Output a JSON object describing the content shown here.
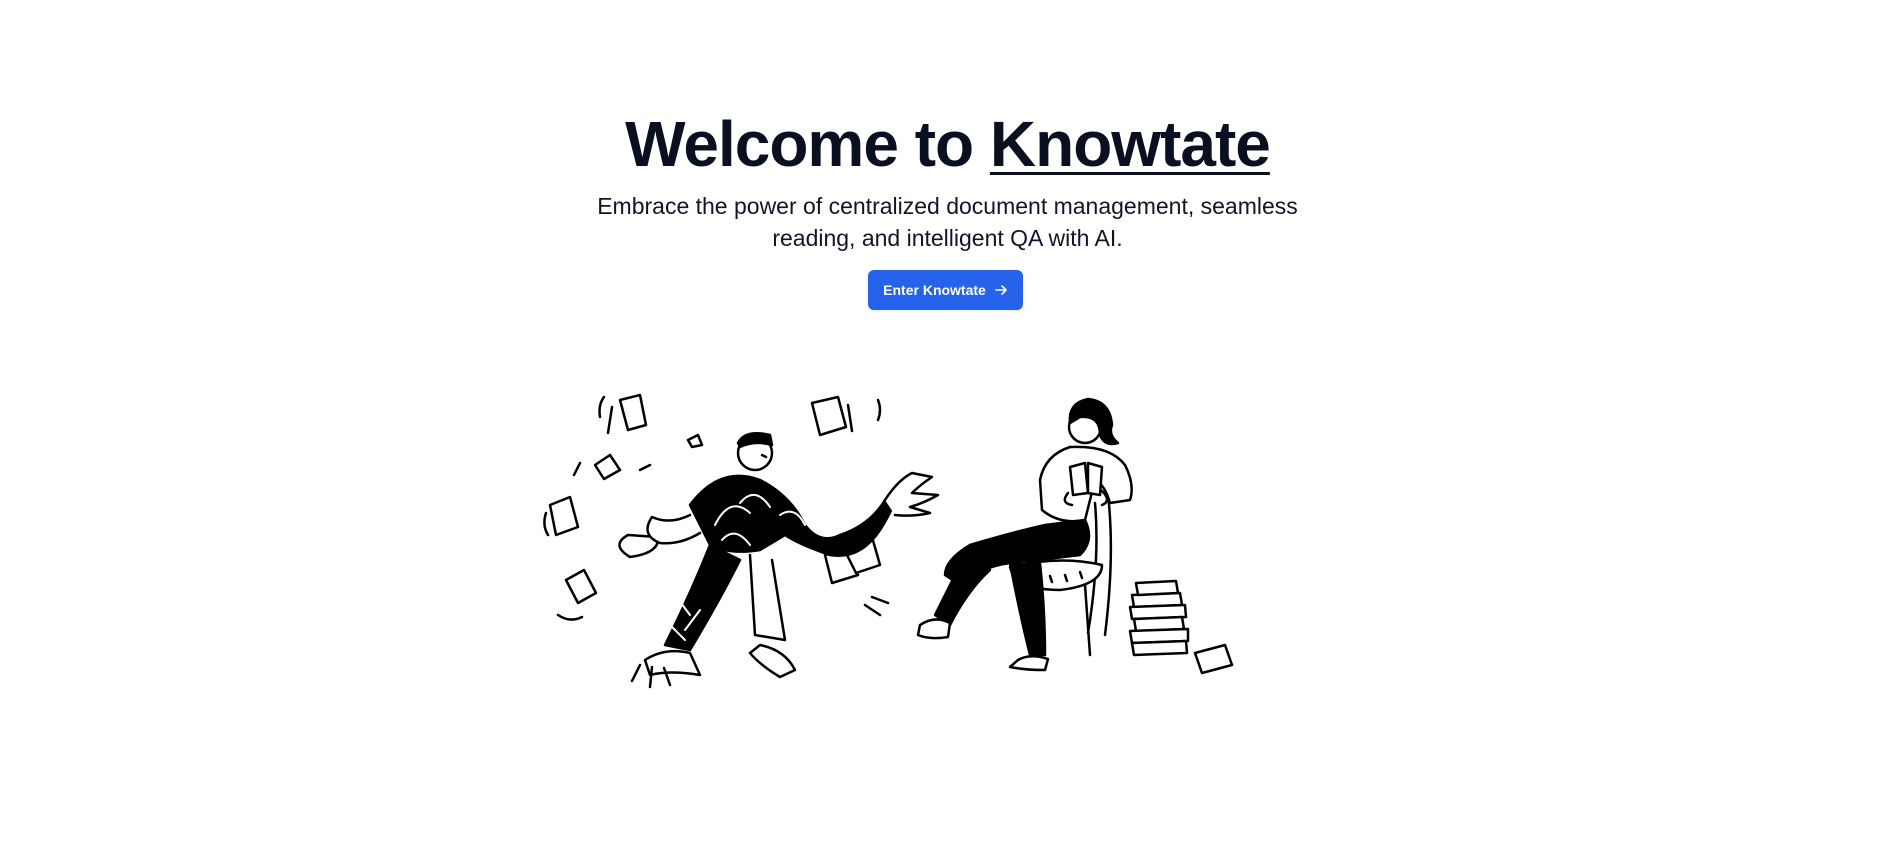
{
  "hero": {
    "title_prefix": "Welcome to ",
    "title_brand": "Knowtate",
    "subtitle": "Embrace the power of centralized document management, seamless reading, and intelligent QA with AI.",
    "cta_label": "Enter Knowtate",
    "cta_icon": "arrow-right-icon"
  },
  "colors": {
    "primary": "#2563eb",
    "text": "#0b1020",
    "background": "#ffffff"
  },
  "illustration": {
    "subjects": [
      "juggling-person",
      "reading-person"
    ]
  }
}
